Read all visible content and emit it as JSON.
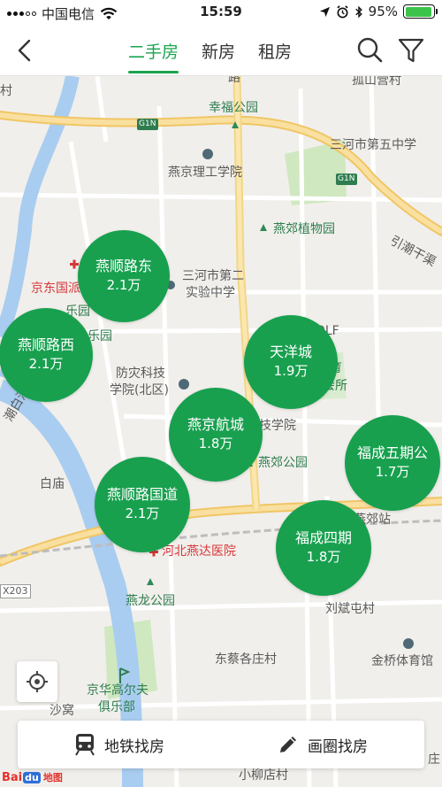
{
  "status_bar": {
    "carrier": "中国电信",
    "time": "15:59",
    "battery": "95%",
    "battery_level": 0.95
  },
  "nav": {
    "tabs": [
      {
        "label": "二手房",
        "active": true
      },
      {
        "label": "新房",
        "active": false
      },
      {
        "label": "租房",
        "active": false
      }
    ],
    "icons": [
      "back-icon",
      "search-icon",
      "filter-icon"
    ]
  },
  "map": {
    "labels": {
      "road_lu": "路",
      "guli_ying": "孤山营村",
      "xingfu_park": "幸福公园",
      "g1n_a": "G1N",
      "g1n_b": "G1N",
      "sanhe_5": "三河市第五中学",
      "yanjing_ligong": "燕京理工学院",
      "yanjiao_botanical": "燕郊植物园",
      "yinlu_gan": "引潮干渠",
      "sanhe_2_a": "三河市第二",
      "sanhe_2_b": "实验中学",
      "jingdong_hospital": "京东国派",
      "leyuan_a": "乐园",
      "leyuan_b": "乐园",
      "fangzai_a": "防灾科技",
      "fangzai_b": "学院(北区)",
      "golf": "燕郊GOLF",
      "tiyu_a": "体育",
      "tiyu_b": "动会所",
      "jixueyuan": "技学院",
      "yanjiao_park": "燕郊公园",
      "chaobai": "潮白河",
      "baimiao": "白庙",
      "yanjiao_station": "燕郊站",
      "hebei_hospital": "河北燕达医院",
      "x203": "X203",
      "yanlong_park": "燕龙公园",
      "liubin_tun": "刘斌屯村",
      "dongcai": "东蔡各庄村",
      "jinqiao": "金桥体育馆",
      "jinghua_a": "京华高尔夫",
      "jinghua_b": "俱乐部",
      "shawo": "沙窝",
      "xiaoliudian": "小柳店村",
      "ke_cun": "村",
      "zhuang": "庄"
    },
    "bubbles": [
      {
        "name": "燕顺路东",
        "price": "2.1万"
      },
      {
        "name": "燕顺路西",
        "price": "2.1万"
      },
      {
        "name": "天洋城",
        "price": "1.9万"
      },
      {
        "name": "燕京航城",
        "price": "1.8万"
      },
      {
        "name": "福成五期公",
        "price": "1.7万"
      },
      {
        "name": "燕顺路国道",
        "price": "2.1万"
      },
      {
        "name": "福成四期",
        "price": "1.8万"
      }
    ]
  },
  "bottom_bar": {
    "subway_label": "地铁找房",
    "draw_label": "画圈找房"
  },
  "baidu": {
    "ba": "Bai",
    "du": "du",
    "map": "地图"
  },
  "colors": {
    "accent": "#1aa44f",
    "bubble": "#18a04f",
    "road_major": "#f5d27a",
    "water": "#a9cdf0",
    "park": "#cfe8c0"
  }
}
